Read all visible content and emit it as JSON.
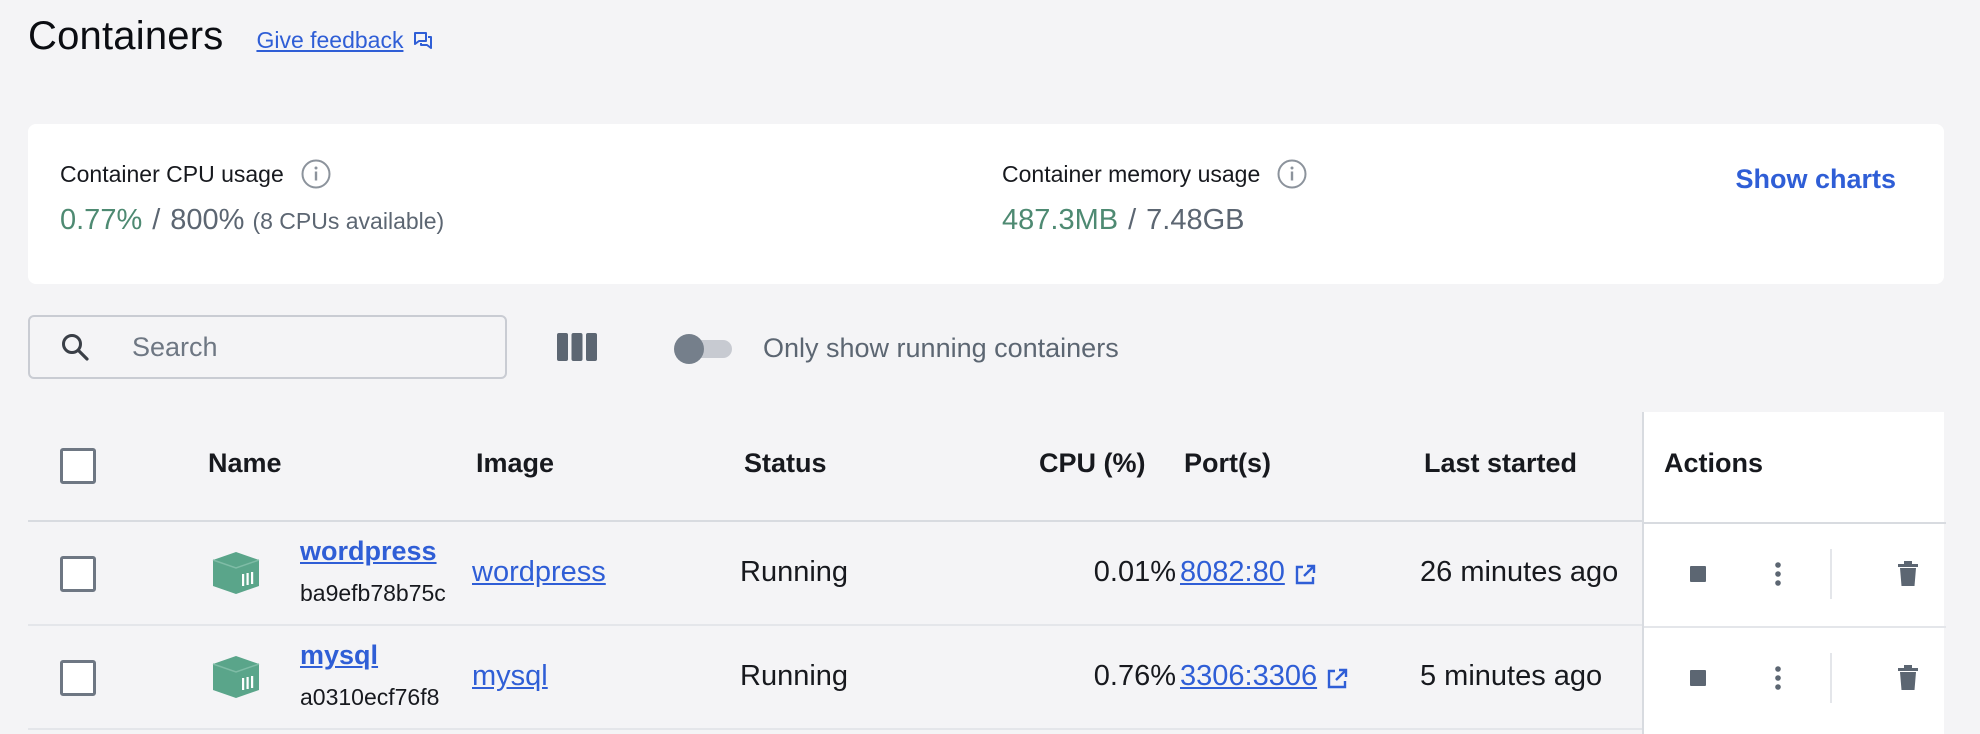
{
  "header": {
    "title": "Containers",
    "feedback_label": "Give feedback"
  },
  "stats": {
    "cpu": {
      "label": "Container CPU usage",
      "used": "0.77%",
      "total": "800%",
      "note": "(8 CPUs available)"
    },
    "memory": {
      "label": "Container memory usage",
      "used": "487.3MB",
      "total": "7.48GB"
    },
    "show_charts_label": "Show charts"
  },
  "toolbar": {
    "search_placeholder": "Search",
    "toggle_label": "Only show running containers",
    "toggle_on": false
  },
  "table": {
    "columns": {
      "name": "Name",
      "image": "Image",
      "status": "Status",
      "cpu": "CPU (%)",
      "ports": "Port(s)",
      "last_started": "Last started",
      "actions": "Actions"
    },
    "rows": [
      {
        "name": "wordpress",
        "id": "ba9efb78b75c",
        "image": "wordpress",
        "status": "Running",
        "cpu": "0.01%",
        "port": "8082:80",
        "last_started": "26 minutes ago"
      },
      {
        "name": "mysql",
        "id": "a0310ecf76f8",
        "image": "mysql",
        "status": "Running",
        "cpu": "0.76%",
        "port": "3306:3306",
        "last_started": "5 minutes ago"
      }
    ]
  },
  "colors": {
    "accent": "#2f5ed6",
    "usage_green": "#4e8a72",
    "container_icon": "#5aa58a"
  }
}
